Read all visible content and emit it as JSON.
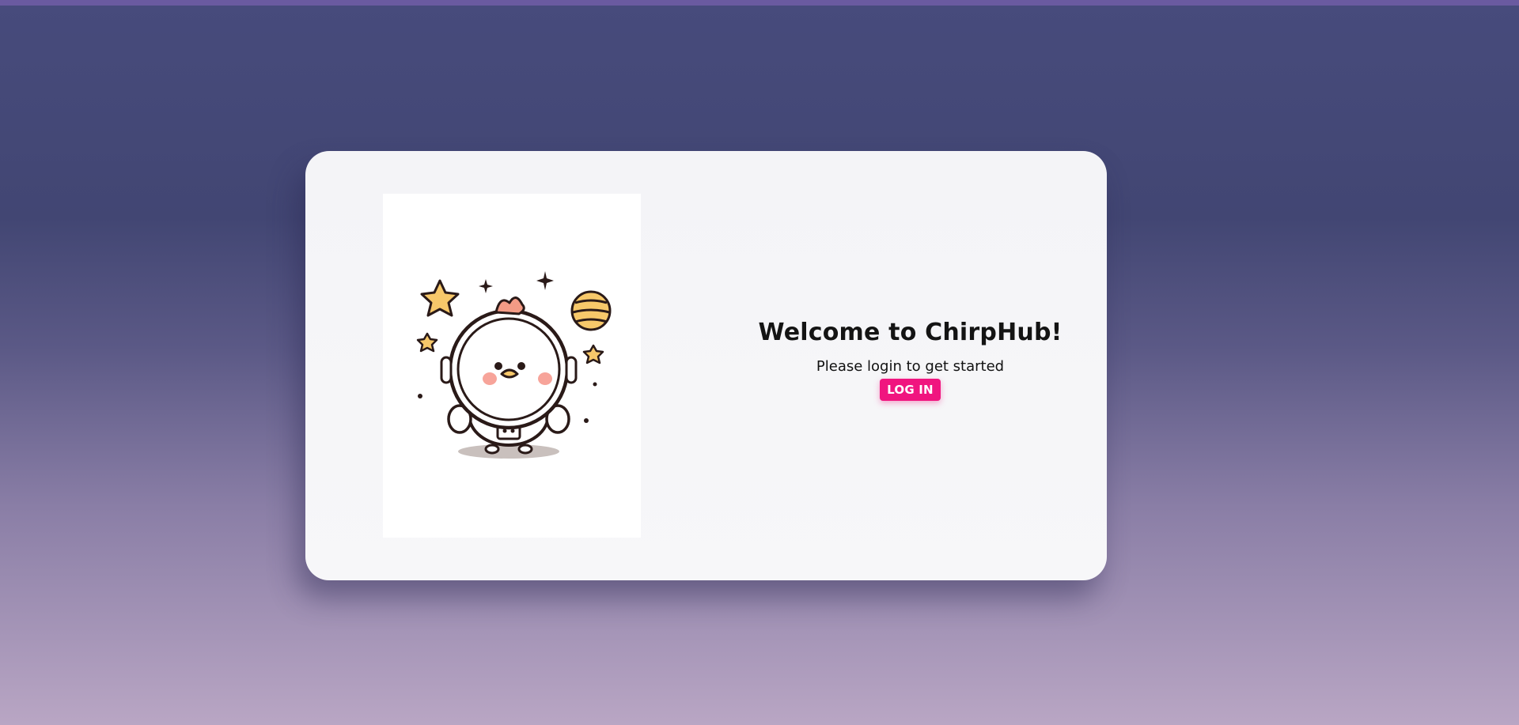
{
  "colors": {
    "accent": "#f0157f",
    "card_background": "#f5f5f8",
    "background_top": "#474b7c",
    "background_bottom": "#b9a6c4"
  },
  "hero_image": {
    "icon": "chick-astronaut-illustration"
  },
  "welcome": {
    "title": "Welcome to ChirpHub!",
    "subtitle": "Please login to get started",
    "login_label": "LOG IN"
  }
}
